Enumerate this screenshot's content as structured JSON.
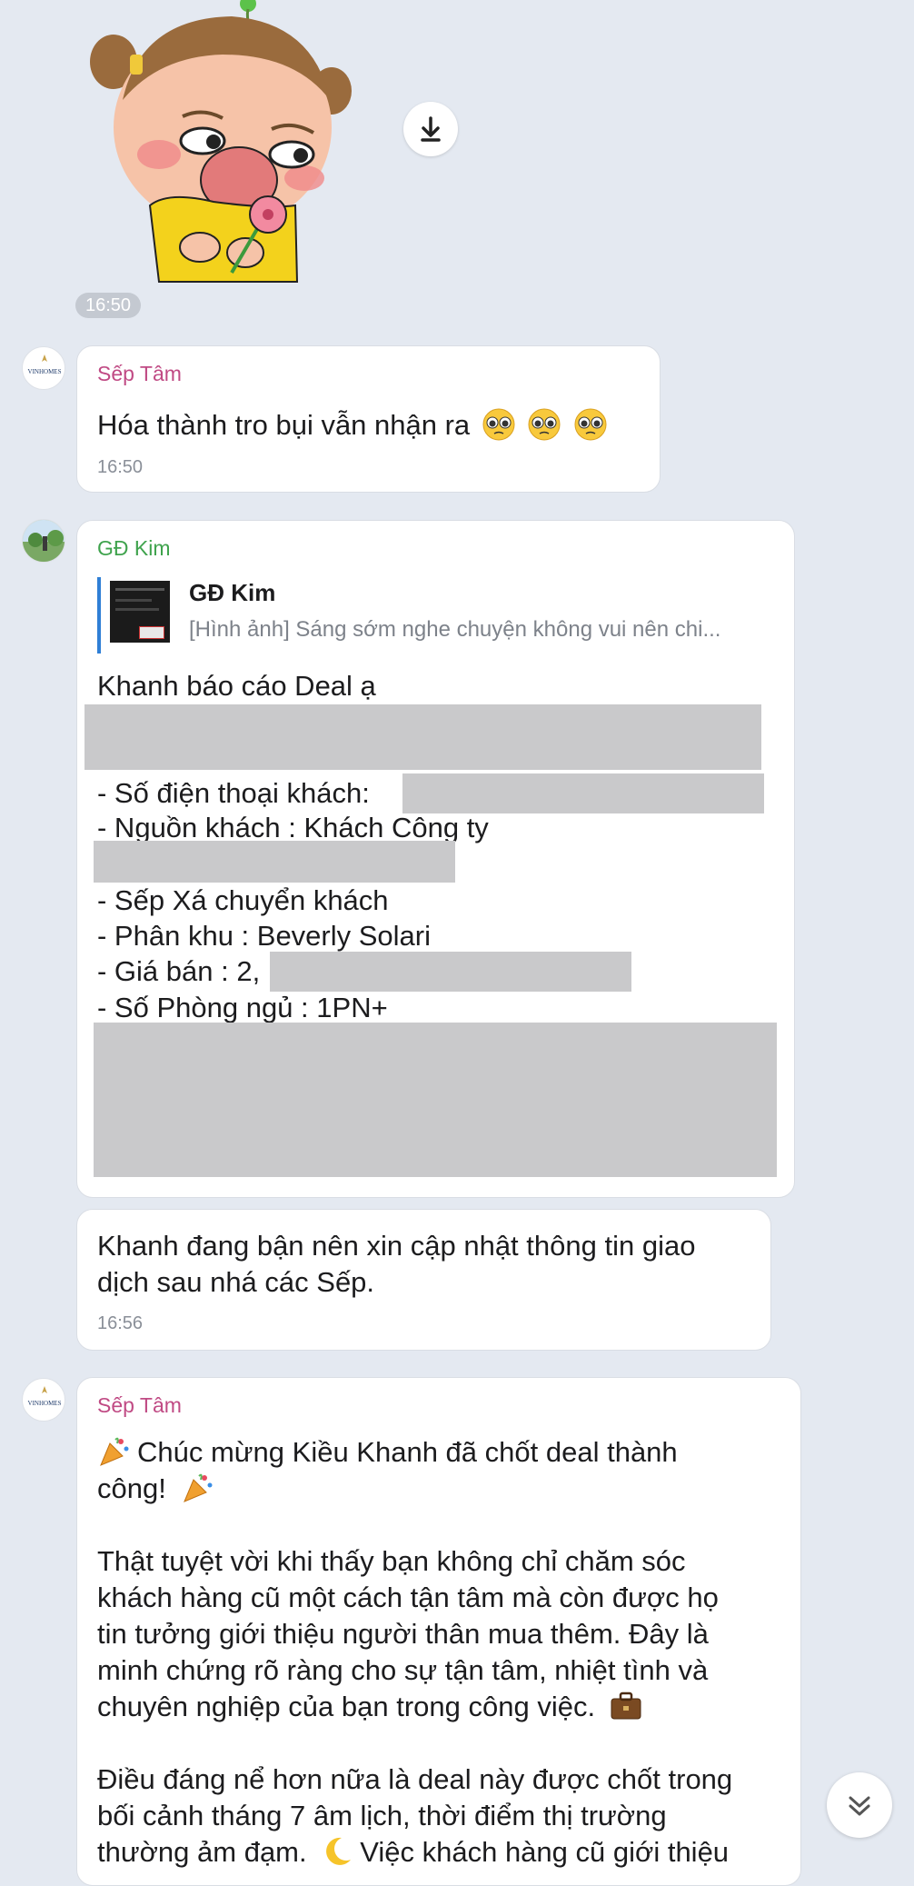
{
  "sticker": {
    "time": "16:50"
  },
  "messages": [
    {
      "id": "m1",
      "sender": "Sếp Tâm",
      "sender_color": "#c04a84",
      "text": "Hóa thành tro bụi vẫn nhận ra",
      "time": "16:50",
      "avatar_text": "VINHOMES"
    },
    {
      "id": "m2",
      "sender": "GĐ Kim",
      "sender_color": "#3fa34d",
      "quote": {
        "name": "GĐ Kim",
        "preview": "[Hình ảnh] Sáng sớm nghe chuyện không vui nên chi..."
      },
      "lines": [
        "Khanh báo cáo Deal ạ",
        "- Số điện thoại khách:",
        "- Nguồn khách : Khách Công ty",
        "- Sếp Xá chuyển khách",
        "- Phân khu : Beverly Solari",
        "- Giá bán : 2,",
        "- Số Phòng ngủ : 1PN+"
      ]
    },
    {
      "id": "m3",
      "lines": [
        "Khanh đang bận nên xin cập nhật thông tin giao",
        "dịch sau nhá các Sếp."
      ],
      "time": "16:56"
    },
    {
      "id": "m4",
      "sender": "Sếp Tâm",
      "sender_color": "#c04a84",
      "avatar_text": "VINHOMES",
      "lines": [
        "Chúc mừng Kiều Khanh đã chốt deal thành",
        "công!",
        "Thật tuyệt vời khi thấy bạn không chỉ chăm sóc",
        "khách hàng cũ một cách tận tâm mà còn được họ",
        "tin tưởng giới thiệu người thân mua thêm. Đây là",
        "minh chứng rõ ràng cho sự tận tâm, nhiệt tình và",
        "chuyên nghiệp của bạn trong công việc.",
        "Điều đáng nể hơn nữa là deal này được chốt trong",
        "bối cảnh tháng 7 âm lịch, thời điểm thị trường",
        "thường ảm đạm.",
        "Việc khách hàng cũ giới thiệu"
      ]
    }
  ],
  "icons": {
    "download": "download-icon",
    "scroll_down": "double-chevron-down-icon",
    "party": "party-popper-icon",
    "briefcase": "briefcase-icon",
    "moon": "crescent-moon-icon",
    "pleading": "pleading-face-icon"
  },
  "colors": {
    "background": "#e4e9f1",
    "bubble": "#ffffff",
    "sender_tam": "#c04a84",
    "sender_kim": "#3fa34d",
    "quote_bar": "#2f7fd6",
    "redaction": "#c9c9cb"
  }
}
